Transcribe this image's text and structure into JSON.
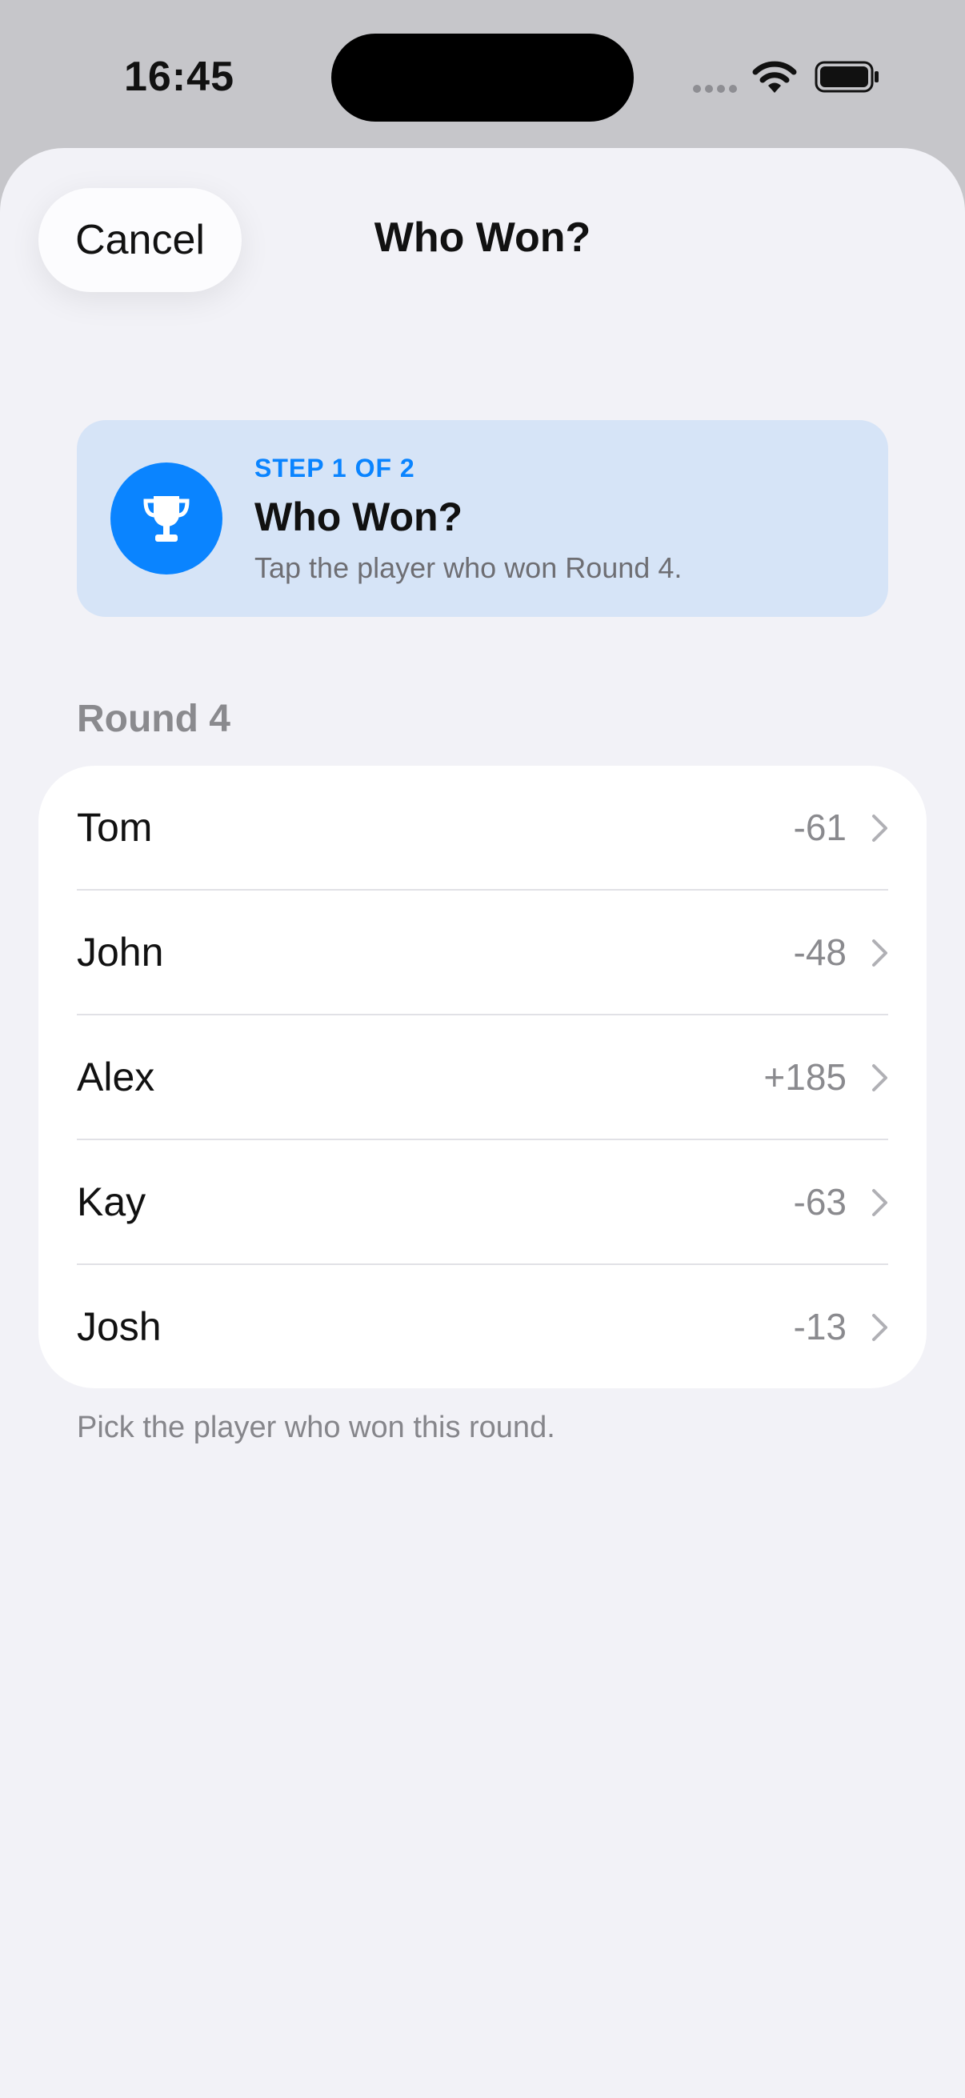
{
  "status_bar": {
    "time": "16:45"
  },
  "nav": {
    "cancel_label": "Cancel",
    "title": "Who Won?"
  },
  "step_card": {
    "icon": "trophy-icon",
    "step_label": "STEP 1 OF 2",
    "title": "Who Won?",
    "description": "Tap the player who won Round 4."
  },
  "section": {
    "title": "Round 4"
  },
  "players": [
    {
      "name": "Tom",
      "score": "-61"
    },
    {
      "name": "John",
      "score": "-48"
    },
    {
      "name": "Alex",
      "score": "+185"
    },
    {
      "name": "Kay",
      "score": "-63"
    },
    {
      "name": "Josh",
      "score": "-13"
    }
  ],
  "footnote": "Pick the player who won this round.",
  "colors": {
    "accent": "#0a84ff",
    "card_background": "#d6e4f7",
    "sheet_background": "#f2f2f7",
    "secondary_text": "#8a8a8e"
  }
}
